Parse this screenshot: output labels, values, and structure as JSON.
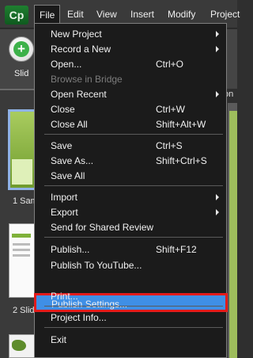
{
  "app": {
    "logo_text": "Cp",
    "accent": "#3f8fe6",
    "highlight_border": "#e21b1b",
    "logo_color": "#1f7f30"
  },
  "menubar": {
    "file": "File",
    "edit": "Edit",
    "view": "View",
    "insert": "Insert",
    "modify": "Modify",
    "project": "Project"
  },
  "toolbar": {
    "slide_label": "Slid",
    "add_icon": "plus-circle-icon"
  },
  "panel": {
    "tab_label": "on"
  },
  "filmstrip": {
    "slide1_label": "1 Sam",
    "slide2_label": "2 Slide",
    "slide2_title": "Slic",
    "slide2_bullets": [
      "• Sub",
      "• Sub",
      "• Sub"
    ]
  },
  "file_menu": {
    "new_project": "New Project",
    "record_new": "Record a New",
    "open": "Open...",
    "open_shortcut": "Ctrl+O",
    "browse_bridge": "Browse in Bridge",
    "open_recent": "Open Recent",
    "close": "Close",
    "close_shortcut": "Ctrl+W",
    "close_all": "Close All",
    "close_all_shortcut": "Shift+Alt+W",
    "save": "Save",
    "save_shortcut": "Ctrl+S",
    "save_as": "Save As...",
    "save_as_shortcut": "Shift+Ctrl+S",
    "save_all": "Save All",
    "import": "Import",
    "export": "Export",
    "send_shared_review": "Send for Shared Review",
    "publish": "Publish...",
    "publish_shortcut": "Shift+F12",
    "publish_youtube": "Publish To YouTube...",
    "publish_settings": "Publish Settings...",
    "print": "Print...",
    "project_info": "Project Info...",
    "exit": "Exit"
  }
}
